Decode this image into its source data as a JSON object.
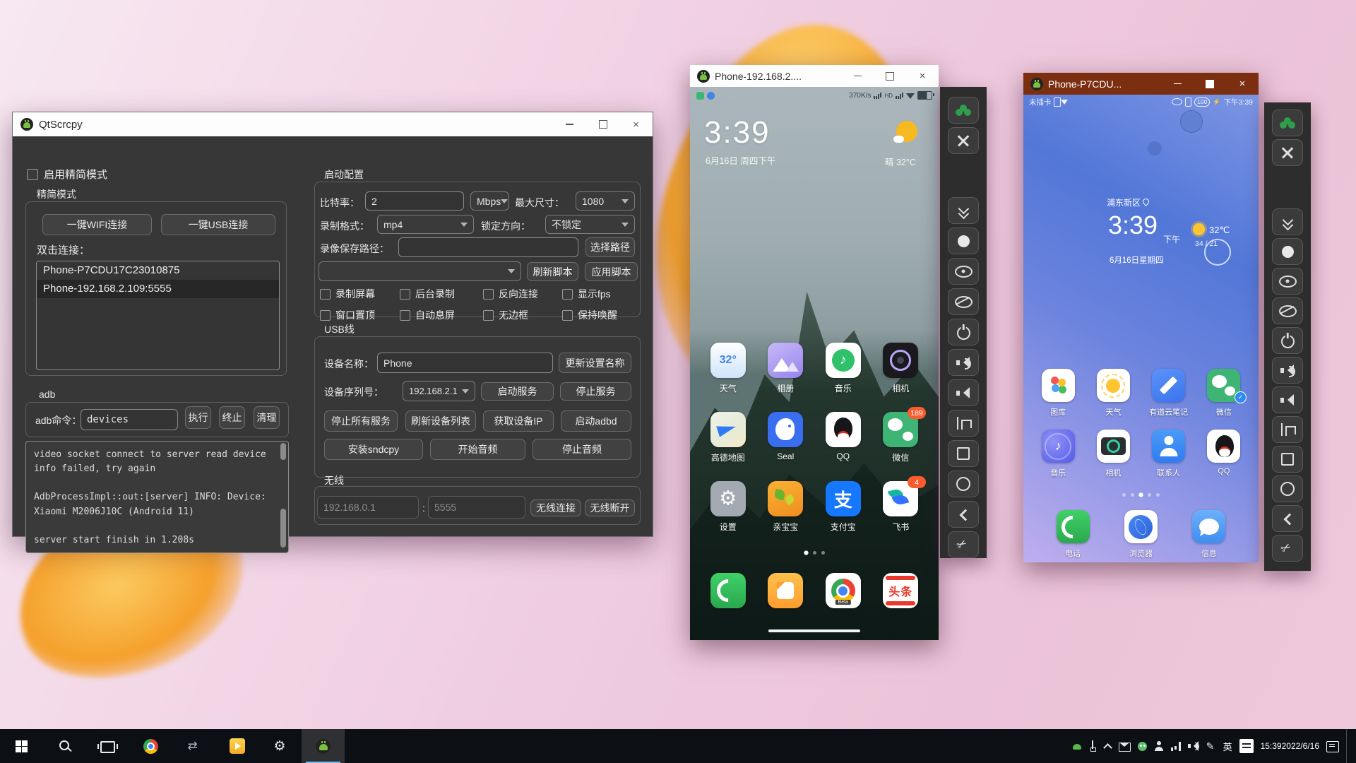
{
  "qtscrcpy": {
    "title": "QtScrcpy",
    "simple_mode_label": "启用精简模式",
    "simple_group_label": "精简模式",
    "wifi_connect": "一键WIFI连接",
    "usb_connect": "一键USB连接",
    "double_click_label": "双击连接：",
    "devices": [
      {
        "name": "Phone-P7CDU17C23010875",
        "selected": false
      },
      {
        "name": "Phone-192.168.2.109:5555",
        "selected": true
      }
    ],
    "adb_label": "adb",
    "adb_cmd_label": "adb命令：",
    "adb_cmd_value": "devices",
    "run_button": "执行",
    "kill_button": "终止",
    "clear_button": "清理",
    "log_text": "video socket connect to server read device\ninfo failed, try again\n\nAdbProcessImpl::out:[server] INFO: Device:\nXiaomi M2006J10C (Android 11)\n\nserver start finish in 1.208s",
    "config": {
      "group_label": "启动配置",
      "bitrate_label": "比特率：",
      "bitrate_value": "2",
      "bitrate_unit": "Mbps",
      "max_size_label": "最大尺寸：",
      "max_size_value": "1080",
      "format_label": "录制格式：",
      "format_value": "mp4",
      "lock_label": "锁定方向：",
      "lock_value": "不锁定",
      "path_label": "录像保存路径：",
      "path_value": "",
      "choose_path_button": "选择路径",
      "refresh_script_button": "刷新脚本",
      "apply_script_button": "应用脚本",
      "checkboxes": [
        "录制屏幕",
        "后台录制",
        "反向连接",
        "显示fps",
        "窗口置顶",
        "自动息屏",
        "无边框",
        "保持唤醒"
      ]
    },
    "usb": {
      "group_label": "USB线",
      "device_name_label": "设备名称：",
      "device_name_value": "Phone",
      "update_name_button": "更新设置名称",
      "serial_label": "设备序列号：",
      "serial_value": "192.168.2.1",
      "start_service_button": "启动服务",
      "stop_service_button": "停止服务",
      "stop_all_button": "停止所有服务",
      "refresh_devices_button": "刷新设备列表",
      "get_ip_button": "获取设备IP",
      "start_adbd_button": "启动adbd",
      "install_sndcpy_button": "安装sndcpy",
      "start_audio_button": "开始音频",
      "stop_audio_button": "停止音频"
    },
    "wireless": {
      "group_label": "无线",
      "ip_value": "192.168.0.1",
      "colon": ":",
      "port_value": "5555",
      "connect_button": "无线连接",
      "disconnect_button": "无线断开"
    }
  },
  "phone1": {
    "title": "Phone-192.168.2....",
    "net_speed": "370K/s",
    "hd_label": "HD",
    "time": "3:39",
    "date": "6月16日 周四下午",
    "weather": "晴  32°C",
    "apps": [
      {
        "label": "天气",
        "icon": "weather",
        "glyph": "32°"
      },
      {
        "label": "相册",
        "icon": "album"
      },
      {
        "label": "音乐",
        "icon": "music",
        "glyph": "♪"
      },
      {
        "label": "相机",
        "icon": "camera"
      },
      {
        "label": "高德地图",
        "icon": "amap"
      },
      {
        "label": "Seal",
        "icon": "seal"
      },
      {
        "label": "QQ",
        "icon": "qq"
      },
      {
        "label": "微信",
        "icon": "wechat",
        "badge": "189"
      },
      {
        "label": "设置",
        "icon": "settings"
      },
      {
        "label": "亲宝宝",
        "icon": "baby"
      },
      {
        "label": "支付宝",
        "icon": "alipay",
        "glyph": "支"
      },
      {
        "label": "飞书",
        "icon": "feishu",
        "badge": "4"
      }
    ],
    "dock": [
      {
        "icon": "phone"
      },
      {
        "icon": "gallery"
      },
      {
        "icon": "chrome",
        "sub": "Beta"
      },
      {
        "icon": "toutiao",
        "glyph": "头条"
      }
    ],
    "dots": [
      {
        "active": true
      },
      {
        "active": false
      },
      {
        "active": false
      }
    ]
  },
  "phone2": {
    "title": "Phone-P7CDU...",
    "status_left": "未插卡",
    "battery": "100",
    "bolt": "⚡",
    "status_time": "下午3:39",
    "location": "浦东新区",
    "time": "3:39",
    "ampm": "下午",
    "temp": "32℃",
    "hilo": "34 / 21",
    "date": "6月16日星期四",
    "apps": [
      {
        "label": "图库",
        "icon": "hw-gallery"
      },
      {
        "label": "天气",
        "icon": "hw-weather"
      },
      {
        "label": "有道云笔记",
        "icon": "youdao"
      },
      {
        "label": "微信",
        "icon": "wechat",
        "badge_check": true
      },
      {
        "label": "音乐",
        "icon": "hw-music",
        "glyph": "♪"
      },
      {
        "label": "相机",
        "icon": "hw-camera"
      },
      {
        "label": "联系人",
        "icon": "contacts"
      },
      {
        "label": "QQ",
        "icon": "qq"
      }
    ],
    "dock": [
      {
        "label": "电话",
        "icon": "phone"
      },
      {
        "label": "浏览器",
        "icon": "browser"
      },
      {
        "label": "信息",
        "icon": "message"
      }
    ],
    "dots": [
      {
        "active": false
      },
      {
        "active": false
      },
      {
        "active": true
      },
      {
        "active": false
      },
      {
        "active": false
      }
    ]
  },
  "toolbar": {
    "buttons": [
      {
        "name": "group"
      },
      {
        "name": "fullscreen"
      },
      {
        "name": "fold"
      },
      {
        "name": "touch"
      },
      {
        "name": "screen-on"
      },
      {
        "name": "screen-off"
      },
      {
        "name": "power"
      },
      {
        "name": "vol-up"
      },
      {
        "name": "vol-down"
      },
      {
        "name": "rotate"
      },
      {
        "name": "menu"
      },
      {
        "name": "home"
      },
      {
        "name": "back"
      },
      {
        "name": "cut"
      }
    ]
  },
  "taskbar": {
    "apps": [
      {
        "icon": "win"
      },
      {
        "icon": "search"
      },
      {
        "icon": "taskview"
      },
      {
        "icon": "chrome-sm"
      },
      {
        "icon": "flow"
      },
      {
        "icon": "player"
      },
      {
        "icon": "gear"
      },
      {
        "icon": "android-tb",
        "active": true
      }
    ],
    "tray_icons": [
      {
        "icon": "android-mini"
      },
      {
        "icon": "usb-mini"
      },
      {
        "icon": "chevron-up"
      },
      {
        "icon": "mail"
      },
      {
        "icon": "wechat-mini"
      },
      {
        "icon": "person"
      },
      {
        "icon": "network"
      },
      {
        "icon": "volume"
      },
      {
        "icon": "pen"
      }
    ],
    "lang": "英",
    "time": "15:39",
    "date": "2022/6/16"
  }
}
